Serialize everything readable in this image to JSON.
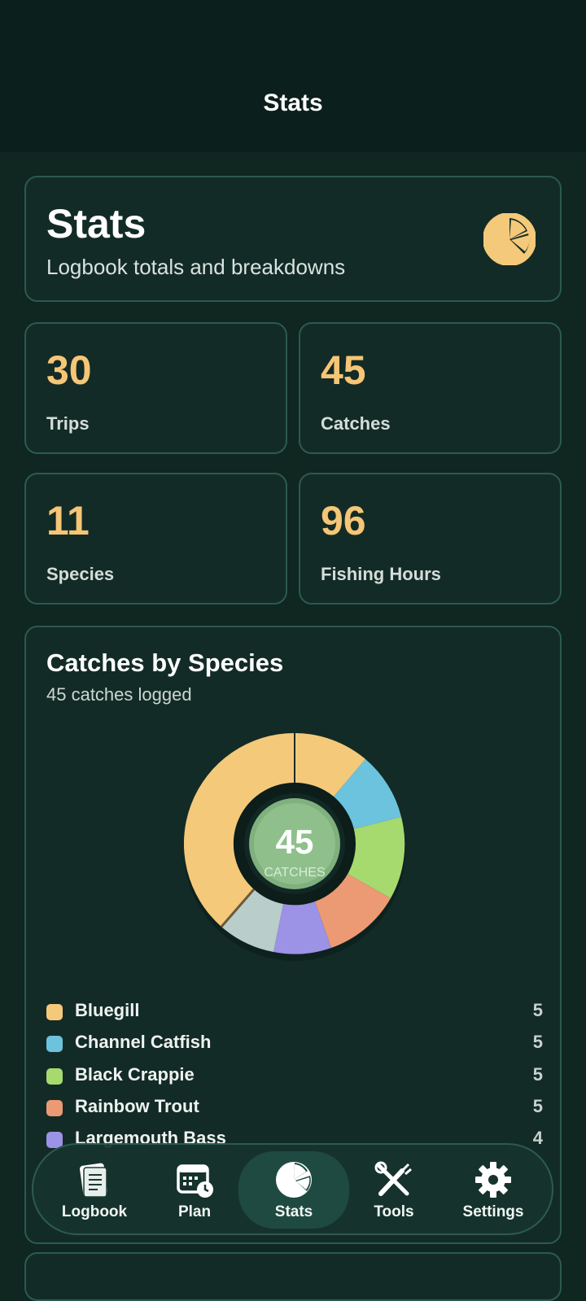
{
  "nav_title": "Stats",
  "hero": {
    "title": "Stats",
    "subtitle": "Logbook totals and breakdowns",
    "icon": "pie-chart-icon"
  },
  "stats": [
    {
      "value": "30",
      "label": "Trips"
    },
    {
      "value": "45",
      "label": "Catches"
    },
    {
      "value": "11",
      "label": "Species"
    },
    {
      "value": "96",
      "label": "Fishing Hours"
    }
  ],
  "species_card": {
    "title": "Catches by Species",
    "subtitle": "45 catches logged",
    "center_value": "45",
    "center_label": "CATCHES",
    "legend": [
      {
        "name": "Bluegill",
        "count": "5",
        "color": "#f5c97a"
      },
      {
        "name": "Channel Catfish",
        "count": "5",
        "color": "#6cc3dd"
      },
      {
        "name": "Black Crappie",
        "count": "5",
        "color": "#a6da6e"
      },
      {
        "name": "Rainbow Trout",
        "count": "5",
        "color": "#ec9a73"
      },
      {
        "name": "Largemouth Bass",
        "count": "4",
        "color": "#9c92e6"
      }
    ]
  },
  "tabs": [
    {
      "label": "Logbook",
      "icon": "logbook-icon",
      "active": false
    },
    {
      "label": "Plan",
      "icon": "calendar-clock-icon",
      "active": false
    },
    {
      "label": "Stats",
      "icon": "pie-chart-icon",
      "active": true
    },
    {
      "label": "Tools",
      "icon": "tools-icon",
      "active": false
    },
    {
      "label": "Settings",
      "icon": "gear-icon",
      "active": false
    }
  ]
}
